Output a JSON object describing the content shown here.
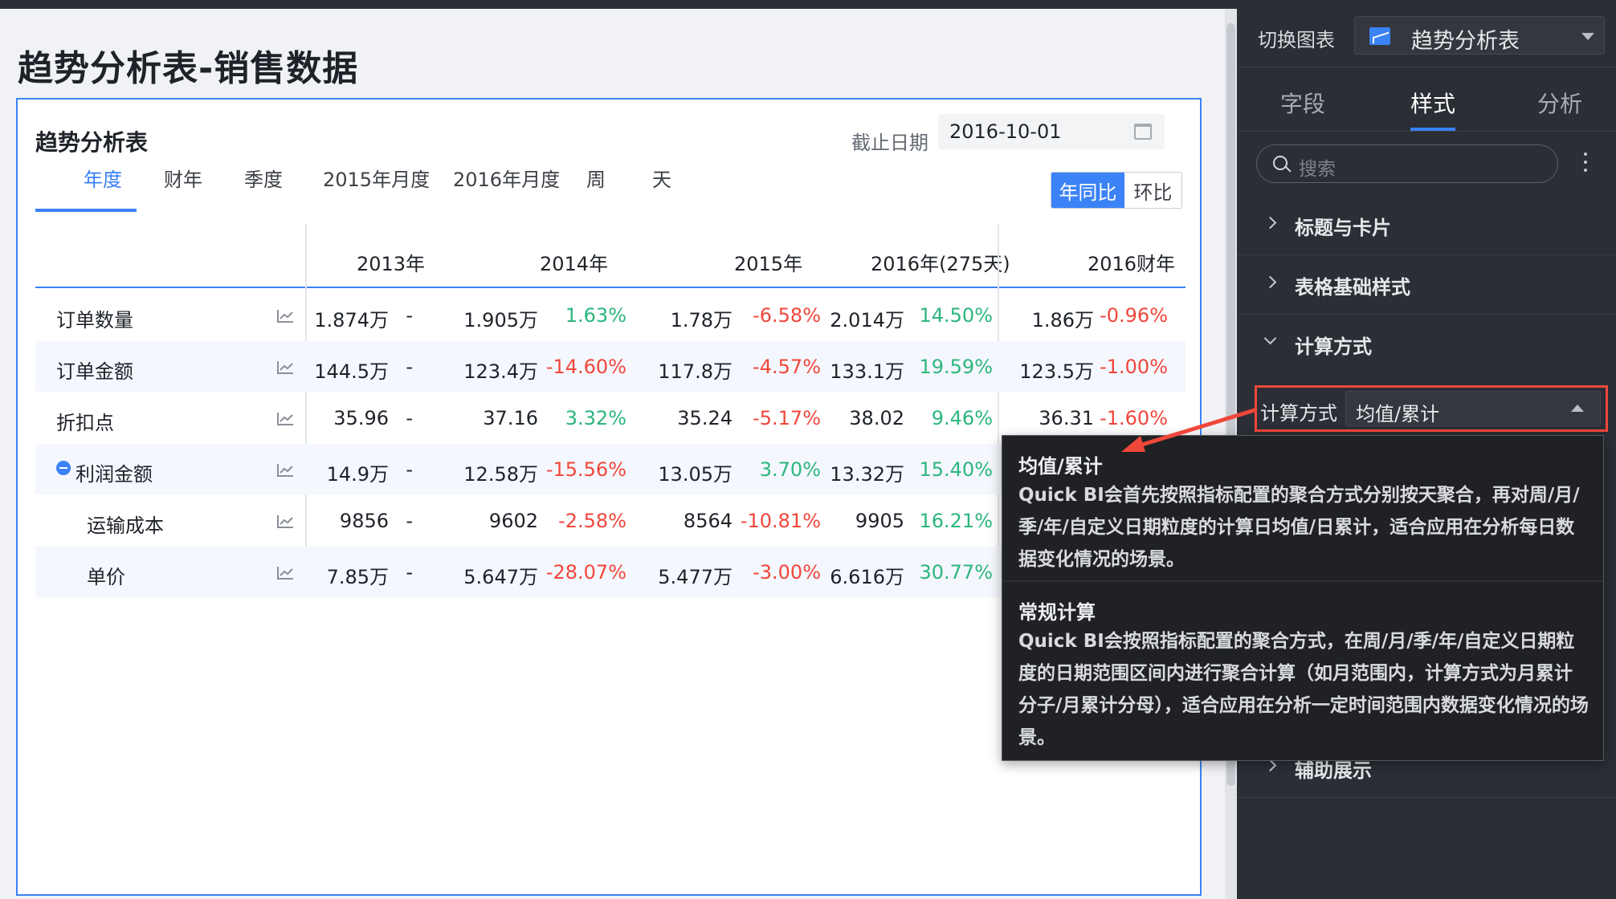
{
  "page": {
    "title": "趋势分析表-销售数据"
  },
  "card": {
    "title": "趋势分析表",
    "date_label": "截止日期",
    "date_value": "2016-10-01",
    "tabs": [
      "年度",
      "财年",
      "季度",
      "2015年月度",
      "2016年月度",
      "周",
      "天"
    ],
    "active_tab": "年度",
    "compare": {
      "yoy": "年同比",
      "mom": "环比",
      "active": "年同比"
    }
  },
  "table": {
    "columns": [
      "2013年",
      "2014年",
      "2015年",
      "2016年(275天)",
      "2016财年"
    ],
    "rows": [
      {
        "name": "订单数量",
        "cells": [
          [
            "1.874万",
            "-"
          ],
          [
            "1.905万",
            "1.63%"
          ],
          [
            "1.78万",
            "-6.58%"
          ],
          [
            "2.014万",
            "14.50%"
          ],
          [
            "1.86万",
            "-0.96%"
          ]
        ]
      },
      {
        "name": "订单金额",
        "cells": [
          [
            "144.5万",
            "-"
          ],
          [
            "123.4万",
            "-14.60%"
          ],
          [
            "117.8万",
            "-4.57%"
          ],
          [
            "133.1万",
            "19.59%"
          ],
          [
            "123.5万",
            "-1.00%"
          ]
        ]
      },
      {
        "name": "折扣点",
        "cells": [
          [
            "35.96",
            "-"
          ],
          [
            "37.16",
            "3.32%"
          ],
          [
            "35.24",
            "-5.17%"
          ],
          [
            "38.02",
            "9.46%"
          ],
          [
            "36.31",
            "-1.60%"
          ]
        ]
      },
      {
        "name": "利润金额",
        "cells": [
          [
            "14.9万",
            "-"
          ],
          [
            "12.58万",
            "-15.56%"
          ],
          [
            "13.05万",
            "3.70%"
          ],
          [
            "13.32万",
            "15.40%"
          ]
        ]
      },
      {
        "name": "运输成本",
        "cells": [
          [
            "9856",
            "-"
          ],
          [
            "9602",
            "-2.58%"
          ],
          [
            "8564",
            "-10.81%"
          ],
          [
            "9905",
            "16.21%"
          ]
        ]
      },
      {
        "name": "单价",
        "cells": [
          [
            "7.85万",
            "-"
          ],
          [
            "5.647万",
            "-28.07%"
          ],
          [
            "5.477万",
            "-3.00%"
          ],
          [
            "6.616万",
            "30.77%"
          ]
        ]
      }
    ]
  },
  "panel": {
    "switch_label": "切换图表",
    "switch_value": "趋势分析表",
    "tabs": [
      "字段",
      "样式",
      "分析"
    ],
    "active_tab": "样式",
    "search_placeholder": "搜索",
    "sections": [
      "标题与卡片",
      "表格基础样式",
      "计算方式",
      "辅助展示"
    ],
    "calc": {
      "label": "计算方式",
      "value": "均值/累计"
    }
  },
  "tooltip": {
    "item1_title": "均值/累计",
    "item1_body": "Quick BI会首先按照指标配置的聚合方式分别按天聚合，再对周/月/季/年/自定义日期粒度的计算日均值/日累计，适合应用在分析每日数据变化情况的场景。",
    "item2_title": "常规计算",
    "item2_body": "Quick BI会按照指标配置的聚合方式，在周/月/季/年/自定义日期粒度的日期范围区间内进行聚合计算（如月范围内，计算方式为月累计分子/月累计分母），适合应用在分析一定时间范围内数据变化情况的场景。"
  },
  "colors": {
    "accent": "#3b82f6",
    "up": "#2cb67d",
    "down": "#f0473b",
    "highlight": "#f0473b"
  }
}
